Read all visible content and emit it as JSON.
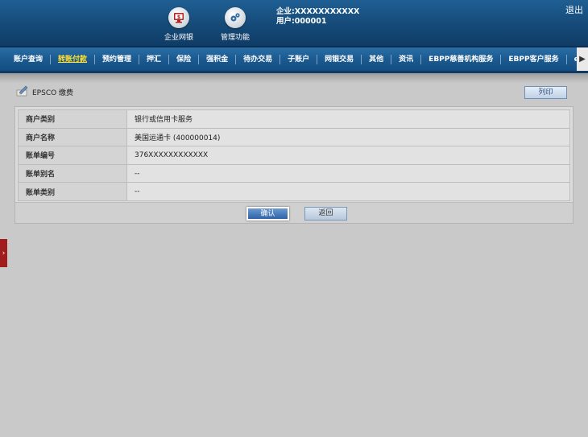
{
  "header": {
    "icons": [
      {
        "name": "企业网银",
        "icon": "monitor-dollar-icon"
      },
      {
        "name": "管理功能",
        "icon": "gears-icon"
      }
    ],
    "company_line": "企业:XXXXXXXXXXX",
    "user_line": "用户:000001",
    "logout_label": "退出"
  },
  "nav": {
    "items": [
      "账户查询",
      "转账付款",
      "预约管理",
      "押汇",
      "保险",
      "强积金",
      "待办交易",
      "子账户",
      "网银交易",
      "其他",
      "资讯",
      "EBPP慈善机构服务",
      "EBPP客户服务",
      "el"
    ],
    "active_index": 1,
    "more_glyph": "▶"
  },
  "page": {
    "title": "EPSCO 缴费",
    "print_label": "列印"
  },
  "details": [
    {
      "label": "商户类别",
      "value": "银行或信用卡服务"
    },
    {
      "label": "商户名称",
      "value": "美国运通卡 (400000014)"
    },
    {
      "label": "账单编号",
      "value": "376XXXXXXXXXXXX"
    },
    {
      "label": "账单别名",
      "value": "--"
    },
    {
      "label": "账单类别",
      "value": "--"
    }
  ],
  "buttons": {
    "confirm_label": "确认",
    "back_label": "返回"
  },
  "side_tab": {
    "glyph": "›"
  },
  "colors": {
    "header_blue": "#154a78",
    "nav_active": "#ffe033",
    "side_tab_red": "#a11c1c"
  }
}
